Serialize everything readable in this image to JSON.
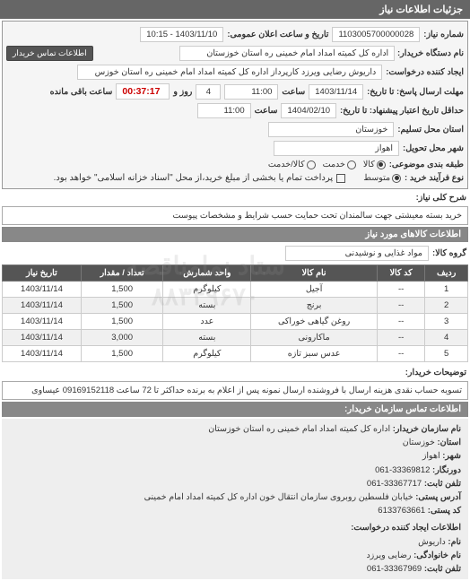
{
  "header": {
    "title": "جزئیات اطلاعات نیاز"
  },
  "top": {
    "number_label": "شماره نیاز:",
    "number": "1103005700000028",
    "datetime_label": "تاریخ و ساعت اعلان عمومی:",
    "datetime": "1403/11/10 - 10:15",
    "buyer_label": "نام دستگاه خریدار:",
    "buyer": "اداره کل کمیته امداد امام خمینی ره  استان خوزستان",
    "contact_btn": "اطلاعات تماس خریدار",
    "requester_label": "ایجاد کننده درخواست:",
    "requester": "داریوش رضایی ویرزد کارپرداز اداره کل کمیته امداد امام خمینی ره  استان خوزس"
  },
  "deadlines": {
    "reply_until_label": "مهلت ارسال پاسخ: تا تاریخ:",
    "reply_date": "1403/11/14",
    "reply_time_label": "ساعت",
    "reply_time": "11:00",
    "days_label": "روز و",
    "days": "4",
    "remain_label": "ساعت باقی مانده",
    "remain": "00:37:17",
    "validity_min_label": "حداقل تاریخ اعتبار پیشنهاد: تا تاریخ:",
    "validity_date": "1404/02/10",
    "validity_time_label": "ساعت",
    "validity_time": "11:00"
  },
  "location": {
    "province_label": "استان محل تسلیم:",
    "province": "خوزستان",
    "city_label": "شهر محل تحویل:",
    "city": "اهواز"
  },
  "budget": {
    "label": "طبقه بندی موضوعی:",
    "options": [
      "کالا",
      "خدمت",
      "کالا/خدمت"
    ],
    "selected": 0,
    "type_label": "نوع فرآیند خرید :",
    "type_options": [
      "متوسط"
    ],
    "type_selected": 0,
    "pay_label": "پرداخت تمام یا بخشی از مبلغ خرید،از محل \"اسناد خزانه اسلامی\" خواهد بود.",
    "pay_checked": false
  },
  "need": {
    "label": "شرح کلی نیاز:",
    "text": "خرید بسته معیشتی جهت سالمندان تحت حمایت حسب شرایط و مشخصات پیوست"
  },
  "goods": {
    "section_title": "اطلاعات کالاهای مورد نیاز",
    "group_label": "گروه کالا:",
    "group": "مواد غذایی و نوشیدنی"
  },
  "table": {
    "headers": [
      "ردیف",
      "کد کالا",
      "نام کالا",
      "واحد شمارش",
      "تعداد / مقدار",
      "تاریخ نیاز"
    ],
    "rows": [
      [
        "1",
        "--",
        "آجیل",
        "کیلوگرم",
        "1,500",
        "1403/11/14"
      ],
      [
        "2",
        "--",
        "برنج",
        "بسته",
        "1,500",
        "1403/11/14"
      ],
      [
        "3",
        "--",
        "روغن گیاهی خوراکی",
        "عدد",
        "1,500",
        "1403/11/14"
      ],
      [
        "4",
        "--",
        "ماکارونی",
        "بسته",
        "3,000",
        "1403/11/14"
      ],
      [
        "5",
        "--",
        "عدس سبز تازه",
        "کیلوگرم",
        "1,500",
        "1403/11/14"
      ]
    ]
  },
  "buyer_note": {
    "label": "توضیحات خریدار:",
    "text": "تسویه حساب نقدی هزینه ارسال با فروشنده ارسال نمونه پس از اعلام به برنده حداکثر تا 72 ساعت 09169152118 عیساوی"
  },
  "contacts": {
    "section_title": "اطلاعات تماس سازمان خریدار:",
    "org_label": "نام سازمان خریدار:",
    "org": "اداره کل کمیته امداد امام خمینی ره استان خوزستان",
    "province_label": "استان:",
    "province": "خوزستان",
    "city_label": "شهر:",
    "city": "اهواز",
    "fax_label": "دورنگار:",
    "fax": "33369812-061",
    "phone_label": "تلفن ثابت:",
    "phone": "33367717-061",
    "postal_addr_label": "آدرس پستی:",
    "postal_addr": "خیابان فلسطین روبروی سازمان انتقال خون اداره کل کمیته امداد امام خمینی",
    "postal_code_label": "کد پستی:",
    "postal_code": "6133763661",
    "creator_section": "اطلاعات ایجاد کننده درخواست:",
    "name_label": "نام:",
    "name": "داریوش",
    "lastname_label": "نام خانوادگی:",
    "lastname": "رضایی ویرزد",
    "creator_phone_label": "تلفن ثابت:",
    "creator_phone": "33367969-061"
  },
  "watermark": {
    "l1": "ستاد نمامناقصه",
    "l2": "۸۸۳۴۹۶۷۰"
  }
}
